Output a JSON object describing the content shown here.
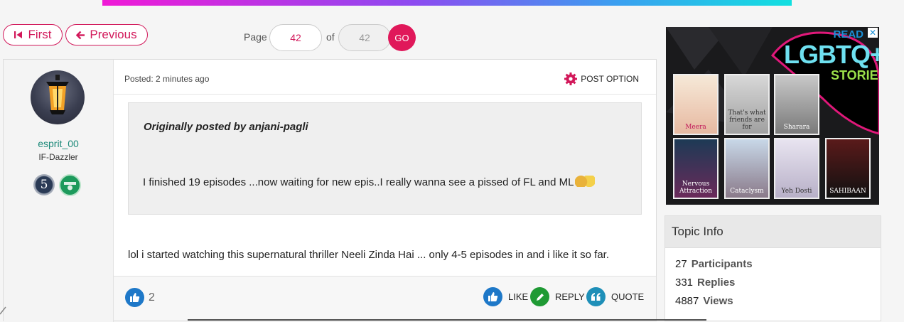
{
  "pagination": {
    "first_label": "First",
    "previous_label": "Previous",
    "page_label": "Page",
    "current_page": "42",
    "of_label": "of",
    "total_pages": "42",
    "go_label": "GO"
  },
  "post": {
    "author": {
      "username": "esprit_00",
      "rank": "IF-Dazzler",
      "level_badge": "5"
    },
    "posted": "Posted: 2 minutes ago",
    "post_option_label": "POST OPTION",
    "quote": {
      "author_line": "Originally posted by anjani-pagli",
      "text": "I finished 19 episodes ...now waiting for new epis..I really wanna see a pissed of FL and ML"
    },
    "body": "lol i started watching this supernatural thriller Neeli Zinda Hai ... only 4-5 episodes in and i like it so far.",
    "like_count": "2",
    "actions": {
      "like": "LIKE",
      "reply": "REPLY",
      "quote": "QUOTE"
    }
  },
  "ad": {
    "read": "READ",
    "headline": "LGBTQ+",
    "subline": "STORIES",
    "close": "✕",
    "books": [
      {
        "title": "Meera"
      },
      {
        "title": "That's what friends are for"
      },
      {
        "title": "Sharara"
      },
      {
        "title": "Nervous Attraction"
      },
      {
        "title": "Cataclysm"
      },
      {
        "title": "Yeh Dosti"
      },
      {
        "title": "SAHIBAAN"
      }
    ]
  },
  "topic_info": {
    "title": "Topic Info",
    "participants_count": "27",
    "participants_label": "Participants",
    "replies_count": "331",
    "replies_label": "Replies",
    "views_count": "4887",
    "views_label": "Views"
  },
  "colors": {
    "accent": "#d2185a",
    "username": "#1d8a7a",
    "like_blue": "#1e78c8",
    "reply_green": "#1f9a34"
  }
}
